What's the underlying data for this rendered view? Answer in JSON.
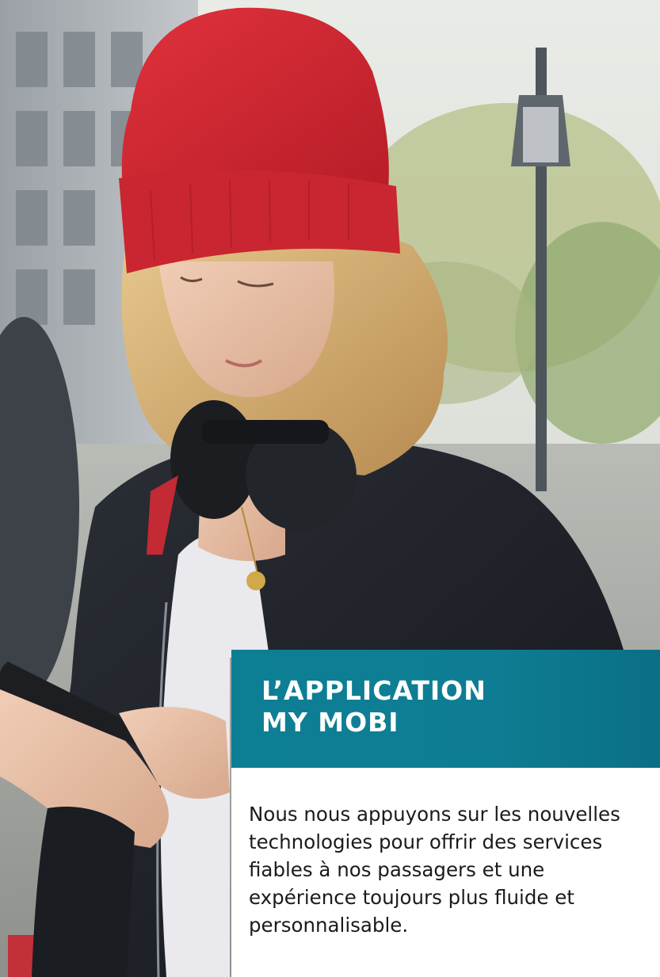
{
  "hero": {
    "image_icon": "woman-with-phone-photo",
    "accent_color": "#0e7d93"
  },
  "section": {
    "title_line1": "L’APPLICATION",
    "title_line2": "MY MOBI",
    "body": "Nous nous appuyons sur les nouvelles technologies pour offrir des services fiables à nos passagers et une expérience toujours plus fluide et personnalisable."
  }
}
